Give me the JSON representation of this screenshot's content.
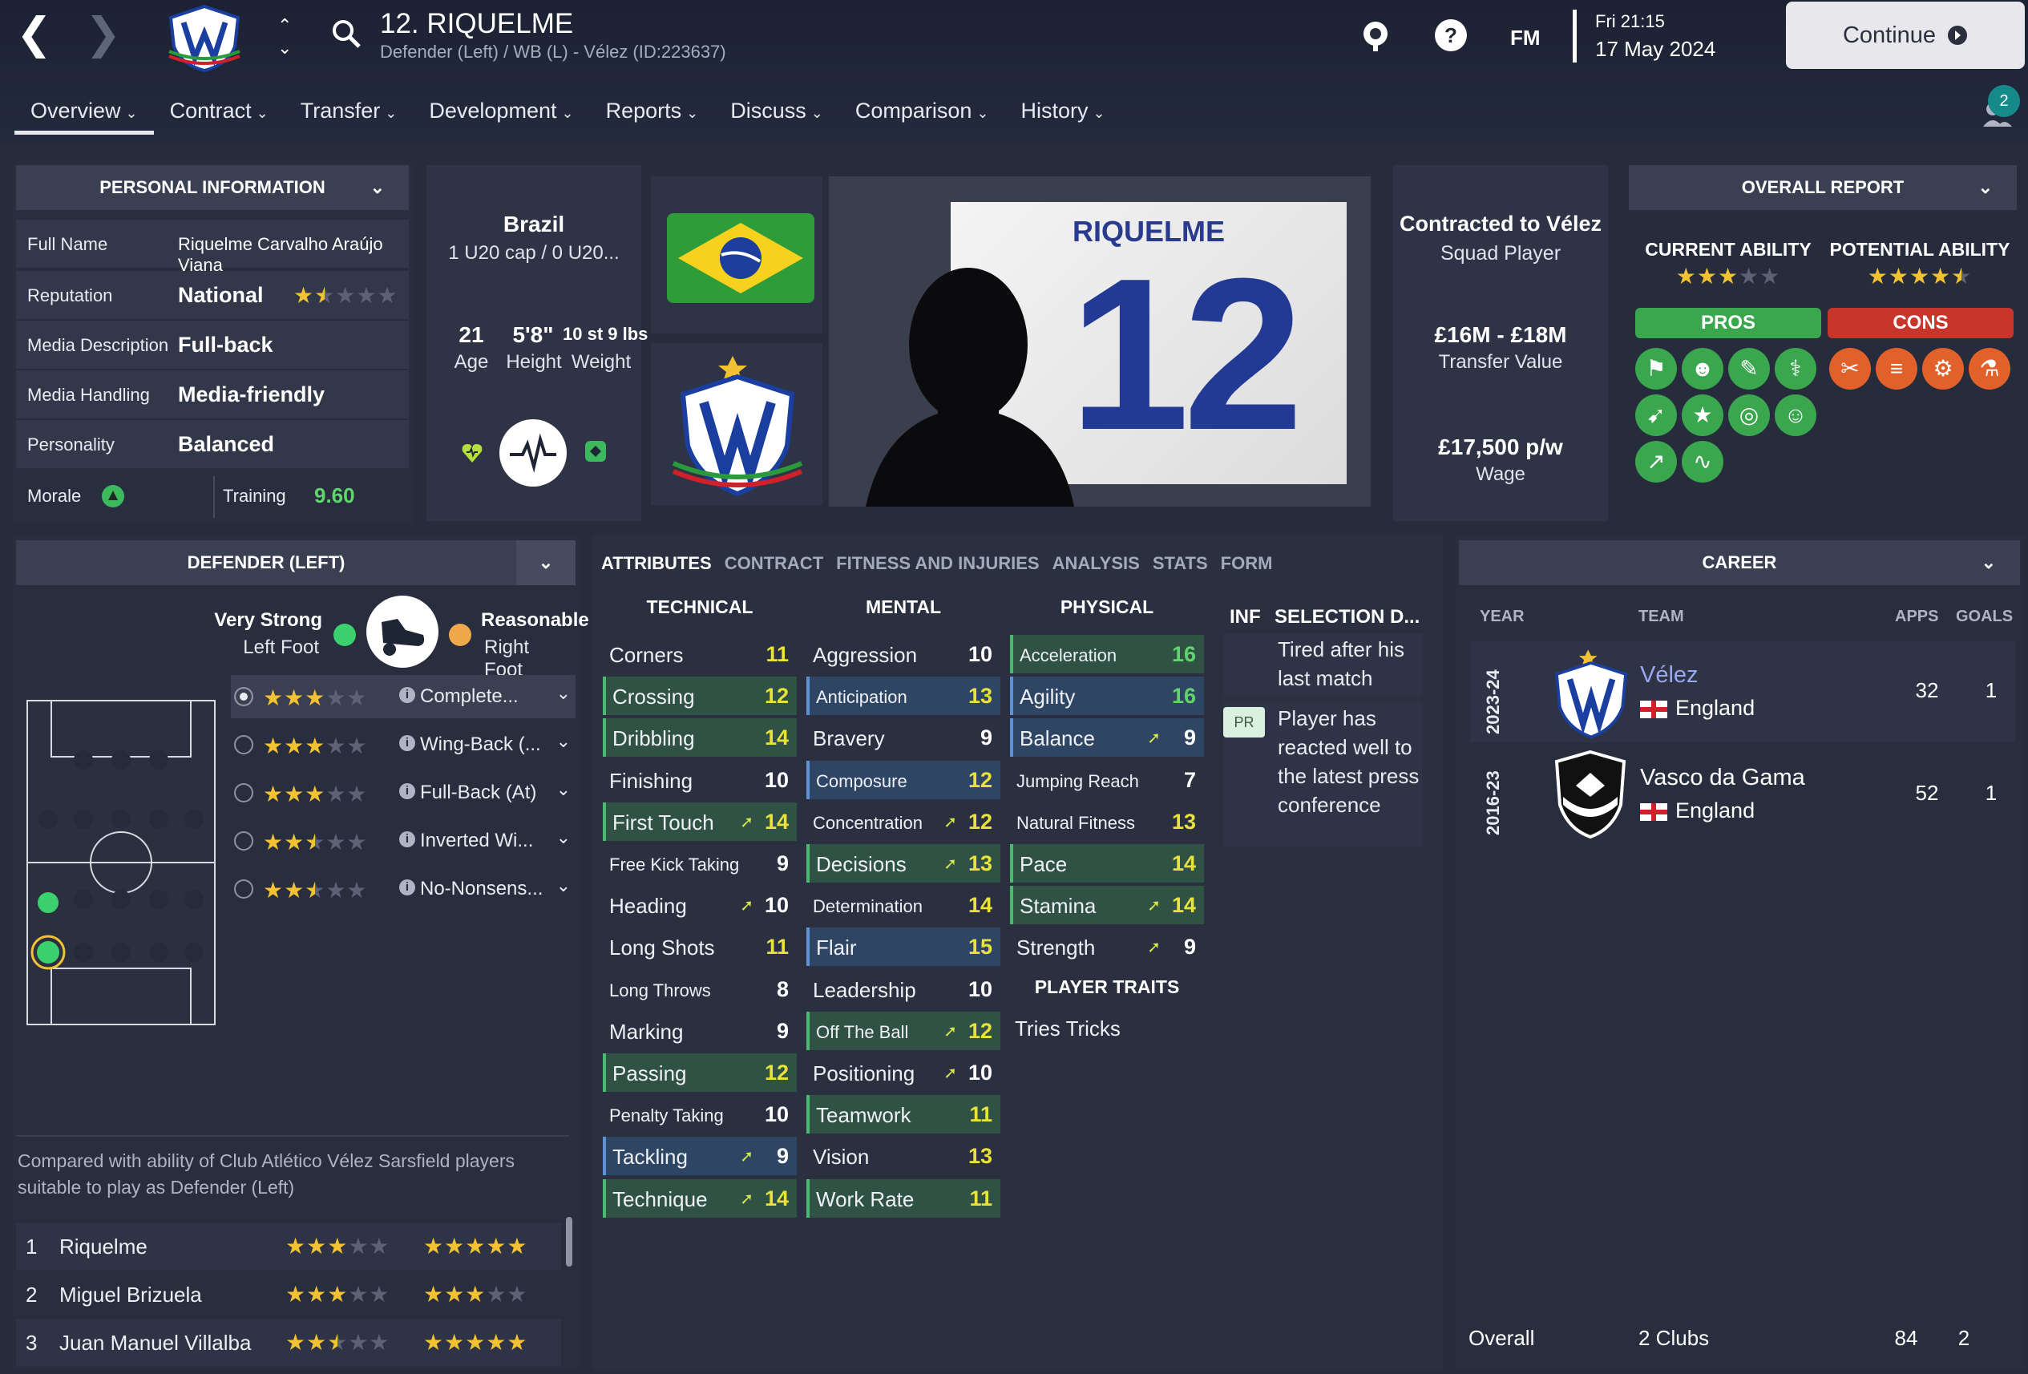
{
  "header": {
    "player_title": "12. RIQUELME",
    "player_subtitle": "Defender (Left) / WB (L) - Vélez (ID:223637)",
    "fm_label": "FM",
    "date_line1": "Fri 21:15",
    "date_line2": "17 May 2024",
    "continue_label": "Continue",
    "notifications": "2"
  },
  "tabs": [
    {
      "label": "Overview"
    },
    {
      "label": "Contract"
    },
    {
      "label": "Transfer"
    },
    {
      "label": "Development"
    },
    {
      "label": "Reports"
    },
    {
      "label": "Discuss"
    },
    {
      "label": "Comparison"
    },
    {
      "label": "History"
    }
  ],
  "personal": {
    "title": "PERSONAL INFORMATION",
    "full_name_label": "Full Name",
    "full_name": "Riquelme Carvalho Araújo Viana",
    "reputation_label": "Reputation",
    "reputation": "National",
    "reputation_stars": 1.5,
    "media_desc_label": "Media Description",
    "media_desc": "Full-back",
    "media_handling_label": "Media Handling",
    "media_handling": "Media-friendly",
    "personality_label": "Personality",
    "personality": "Balanced",
    "morale_label": "Morale",
    "training_label": "Training",
    "training_value": "9.60"
  },
  "bio": {
    "nation": "Brazil",
    "caps": "1 U20 cap / 0 U20...",
    "age": "21",
    "age_label": "Age",
    "height": "5'8\"",
    "height_label": "Height",
    "weight": "10 st 9 lbs",
    "weight_label": "Weight"
  },
  "kit": {
    "name": "RIQUELME",
    "number": "12"
  },
  "contract": {
    "line1": "Contracted to Vélez",
    "line2": "Squad Player",
    "value": "£16M - £18M",
    "value_label": "Transfer Value",
    "wage": "£17,500 p/w",
    "wage_label": "Wage"
  },
  "report": {
    "title": "OVERALL REPORT",
    "ca_label": "CURRENT ABILITY",
    "pa_label": "POTENTIAL ABILITY",
    "ca_stars": 3,
    "pa_stars": 4.5,
    "pros_label": "PROS",
    "cons_label": "CONS",
    "pros_color": "#3aa64e",
    "cons_color": "#c8352b"
  },
  "position": {
    "title": "DEFENDER (LEFT)",
    "left_foot_strength": "Very Strong",
    "left_foot_label": "Left Foot",
    "right_foot_strength": "Reasonable",
    "right_foot_label": "Right Foot",
    "roles": [
      {
        "name": "Complete...",
        "stars": 3
      },
      {
        "name": "Wing-Back (...",
        "stars": 3
      },
      {
        "name": "Full-Back (At)",
        "stars": 3
      },
      {
        "name": "Inverted Wi...",
        "stars": 2.5
      },
      {
        "name": "No-Nonsens...",
        "stars": 2.5
      }
    ],
    "compare_text": "Compared with ability of Club Atlético Vélez Sarsfield players suitable to play as Defender (Left)",
    "compare": [
      {
        "rank": "1",
        "name": "Riquelme",
        "ca": 3,
        "pa": 5
      },
      {
        "rank": "2",
        "name": "Miguel Brizuela",
        "ca": 3,
        "pa": 3
      },
      {
        "rank": "3",
        "name": "Juan Manuel Villalba",
        "ca": 2.5,
        "pa": 5
      }
    ]
  },
  "attr_tabs": [
    "ATTRIBUTES",
    "CONTRACT",
    "FITNESS AND INJURIES",
    "ANALYSIS",
    "STATS",
    "FORM"
  ],
  "technical_title": "TECHNICAL",
  "mental_title": "MENTAL",
  "physical_title": "PHYSICAL",
  "traits_title": "PLAYER TRAITS",
  "trait": "Tries Tricks",
  "technical": [
    {
      "name": "Corners",
      "value": "11",
      "hl": "",
      "arrow": false,
      "sq": false
    },
    {
      "name": "Crossing",
      "value": "12",
      "hl": "g",
      "arrow": false,
      "sq": false
    },
    {
      "name": "Dribbling",
      "value": "14",
      "hl": "g",
      "arrow": false,
      "sq": false
    },
    {
      "name": "Finishing",
      "value": "10",
      "hl": "",
      "arrow": false,
      "sq": false
    },
    {
      "name": "First Touch",
      "value": "14",
      "hl": "g",
      "arrow": true,
      "sq": false
    },
    {
      "name": "Free Kick Taking",
      "value": "9",
      "hl": "",
      "arrow": false,
      "sq": true
    },
    {
      "name": "Heading",
      "value": "10",
      "hl": "",
      "arrow": true,
      "sq": false
    },
    {
      "name": "Long Shots",
      "value": "11",
      "hl": "",
      "arrow": false,
      "sq": false
    },
    {
      "name": "Long Throws",
      "value": "8",
      "hl": "",
      "arrow": false,
      "sq": true
    },
    {
      "name": "Marking",
      "value": "9",
      "hl": "",
      "arrow": false,
      "sq": false
    },
    {
      "name": "Passing",
      "value": "12",
      "hl": "g",
      "arrow": false,
      "sq": false
    },
    {
      "name": "Penalty Taking",
      "value": "10",
      "hl": "",
      "arrow": false,
      "sq": true
    },
    {
      "name": "Tackling",
      "value": "9",
      "hl": "b",
      "arrow": true,
      "sq": false
    },
    {
      "name": "Technique",
      "value": "14",
      "hl": "g",
      "arrow": true,
      "sq": false
    }
  ],
  "mental": [
    {
      "name": "Aggression",
      "value": "10",
      "hl": "",
      "arrow": false,
      "sq": false
    },
    {
      "name": "Anticipation",
      "value": "13",
      "hl": "b",
      "arrow": false,
      "sq": true
    },
    {
      "name": "Bravery",
      "value": "9",
      "hl": "",
      "arrow": false,
      "sq": false
    },
    {
      "name": "Composure",
      "value": "12",
      "hl": "b",
      "arrow": false,
      "sq": true
    },
    {
      "name": "Concentration",
      "value": "12",
      "hl": "",
      "arrow": true,
      "sq": true
    },
    {
      "name": "Decisions",
      "value": "13",
      "hl": "g",
      "arrow": true,
      "sq": false
    },
    {
      "name": "Determination",
      "value": "14",
      "hl": "",
      "arrow": false,
      "sq": true
    },
    {
      "name": "Flair",
      "value": "15",
      "hl": "b",
      "arrow": false,
      "sq": false
    },
    {
      "name": "Leadership",
      "value": "10",
      "hl": "",
      "arrow": false,
      "sq": false
    },
    {
      "name": "Off The Ball",
      "value": "12",
      "hl": "g",
      "arrow": true,
      "sq": true
    },
    {
      "name": "Positioning",
      "value": "10",
      "hl": "",
      "arrow": true,
      "sq": false
    },
    {
      "name": "Teamwork",
      "value": "11",
      "hl": "g",
      "arrow": false,
      "sq": false
    },
    {
      "name": "Vision",
      "value": "13",
      "hl": "",
      "arrow": false,
      "sq": false
    },
    {
      "name": "Work Rate",
      "value": "11",
      "hl": "g",
      "arrow": false,
      "sq": false
    }
  ],
  "physical": [
    {
      "name": "Acceleration",
      "value": "16",
      "hl": "g",
      "arrow": false,
      "sq": true
    },
    {
      "name": "Agility",
      "value": "16",
      "hl": "b",
      "arrow": false,
      "sq": false
    },
    {
      "name": "Balance",
      "value": "9",
      "hl": "b",
      "arrow": true,
      "sq": false
    },
    {
      "name": "Jumping Reach",
      "value": "7",
      "hl": "",
      "arrow": false,
      "sq": true
    },
    {
      "name": "Natural Fitness",
      "value": "13",
      "hl": "",
      "arrow": false,
      "sq": true
    },
    {
      "name": "Pace",
      "value": "14",
      "hl": "g",
      "arrow": false,
      "sq": false
    },
    {
      "name": "Stamina",
      "value": "14",
      "hl": "g",
      "arrow": true,
      "sq": false
    },
    {
      "name": "Strength",
      "value": "9",
      "hl": "",
      "arrow": true,
      "sq": false
    }
  ],
  "inf": {
    "label": "INF",
    "selection_label": "SELECTION D...",
    "note1": "Tired after his last match",
    "pr_badge": "PR",
    "note2": "Player has reacted well to the latest press conference"
  },
  "career": {
    "title": "CAREER",
    "col_year": "YEAR",
    "col_team": "TEAM",
    "col_apps": "APPS",
    "col_goals": "GOALS",
    "rows": [
      {
        "year": "2023-24",
        "team": "Vélez",
        "nation": "England",
        "apps": "32",
        "goals": "1"
      },
      {
        "year": "2016-23",
        "team": "Vasco da Gama",
        "nation": "England",
        "apps": "52",
        "goals": "1"
      }
    ],
    "total_label": "Overall",
    "total_clubs": "2 Clubs",
    "total_apps": "84",
    "total_goals": "2"
  }
}
